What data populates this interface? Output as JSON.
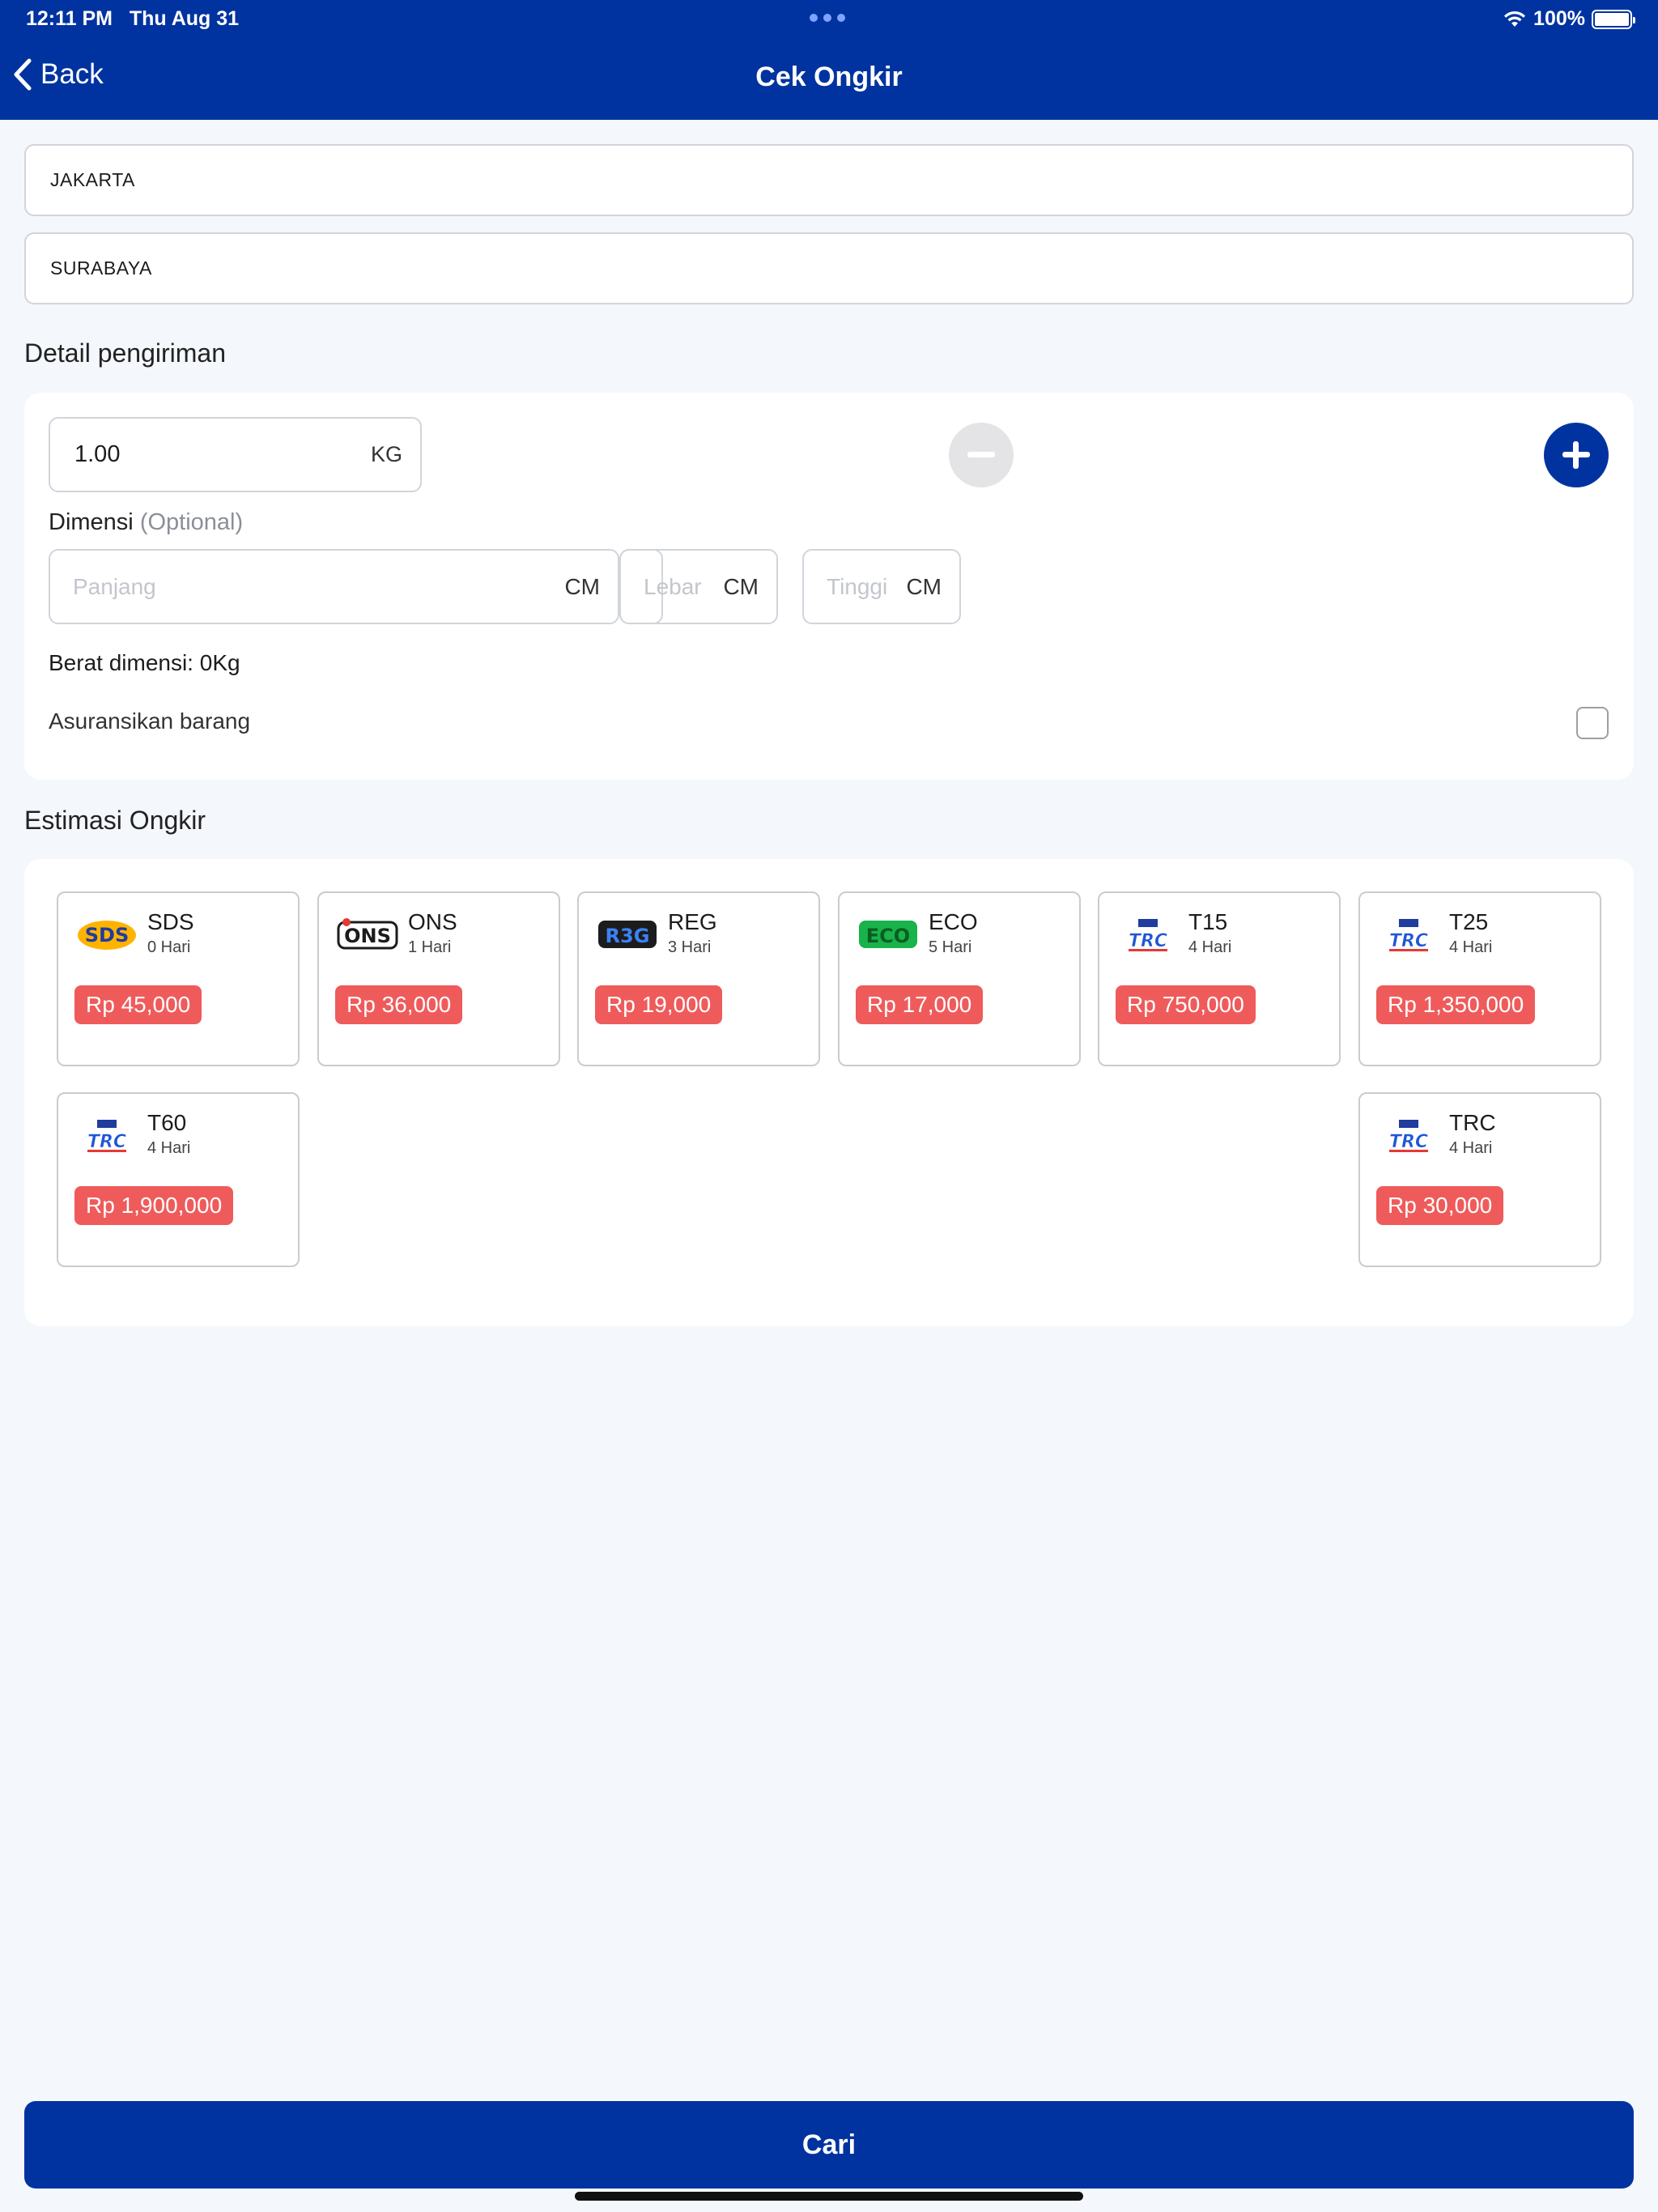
{
  "status_bar": {
    "time": "12:11 PM",
    "date": "Thu Aug 31",
    "battery": "100%"
  },
  "nav": {
    "back_label": "Back",
    "title": "Cek Ongkir"
  },
  "origin": {
    "value": "JAKARTA"
  },
  "destination": {
    "value": "SURABAYA"
  },
  "details": {
    "section_title": "Detail pengiriman",
    "weight": {
      "value": "1.00",
      "unit": "KG"
    },
    "dimension_label": "Dimensi",
    "dimension_optional": "(Optional)",
    "length": {
      "placeholder": "Panjang",
      "unit": "CM"
    },
    "width": {
      "placeholder": "Lebar",
      "unit": "CM"
    },
    "height": {
      "placeholder": "Tinggi",
      "unit": "CM"
    },
    "dimension_weight": "Berat dimensi: 0Kg",
    "insurance_label": "Asuransikan barang",
    "insurance_checked": false
  },
  "estimate": {
    "section_title": "Estimasi Ongkir",
    "couriers": [
      {
        "name": "SDS",
        "days": "0 Hari",
        "price": "Rp 45,000",
        "logo_text": "SDS"
      },
      {
        "name": "ONS",
        "days": "1 Hari",
        "price": "Rp 36,000",
        "logo_text": "ONS"
      },
      {
        "name": "REG",
        "days": "3 Hari",
        "price": "Rp 19,000",
        "logo_text": "R3G"
      },
      {
        "name": "ECO",
        "days": "5 Hari",
        "price": "Rp 17,000",
        "logo_text": "ECO"
      },
      {
        "name": "T15",
        "days": "4 Hari",
        "price": "Rp 750,000",
        "logo_text": "TRC"
      },
      {
        "name": "T25",
        "days": "4 Hari",
        "price": "Rp 1,350,000",
        "logo_text": "TRC"
      },
      {
        "name": "T60",
        "days": "4 Hari",
        "price": "Rp 1,900,000",
        "logo_text": "TRC"
      },
      {
        "name": "TRC",
        "days": "4 Hari",
        "price": "Rp 30,000",
        "logo_text": "TRC"
      }
    ]
  },
  "search_button": {
    "label": "Cari"
  },
  "colors": {
    "primary": "#0033a0",
    "price_badge": "#ef5b5b",
    "background": "#f4f7fc"
  }
}
